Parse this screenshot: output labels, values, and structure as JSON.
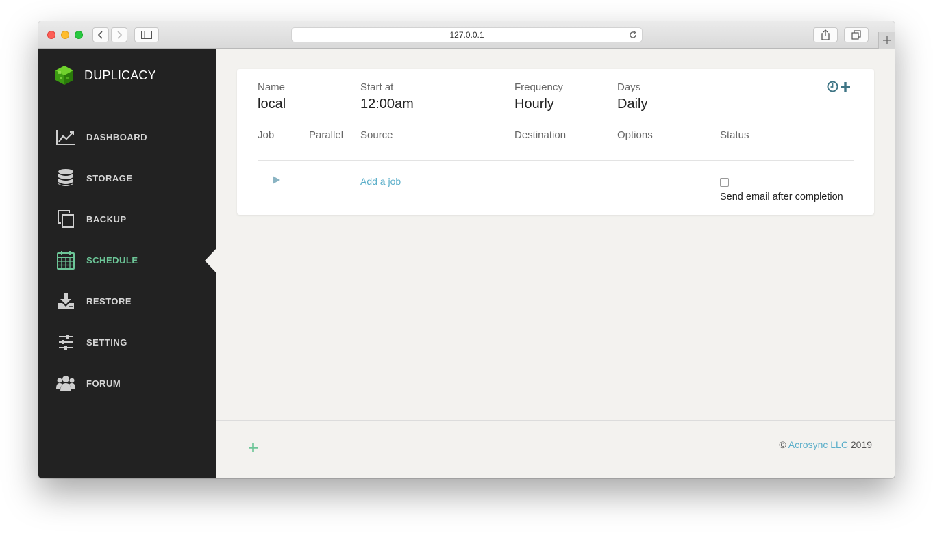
{
  "browser": {
    "url": "127.0.0.1"
  },
  "app": {
    "brand": "DUPLICACY",
    "brand_color": "#4caf1f"
  },
  "sidebar": {
    "items": [
      {
        "label": "DASHBOARD",
        "icon": "chart-line-icon",
        "active": false
      },
      {
        "label": "STORAGE",
        "icon": "database-icon",
        "active": false
      },
      {
        "label": "BACKUP",
        "icon": "copy-icon",
        "active": false
      },
      {
        "label": "SCHEDULE",
        "icon": "calendar-icon",
        "active": true
      },
      {
        "label": "RESTORE",
        "icon": "download-icon",
        "active": false
      },
      {
        "label": "SETTING",
        "icon": "sliders-icon",
        "active": false
      },
      {
        "label": "FORUM",
        "icon": "users-icon",
        "active": false
      }
    ],
    "active_color": "#6cc597"
  },
  "schedule": {
    "name_label": "Name",
    "name": "local",
    "start_label": "Start at",
    "start": "12:00am",
    "frequency_label": "Frequency",
    "frequency": "Hourly",
    "days_label": "Days",
    "days": "Daily",
    "columns": [
      "Job",
      "Parallel",
      "Source",
      "Destination",
      "Options",
      "Status"
    ],
    "add_job_label": "Add a job",
    "email_label": "Send email after completion",
    "email_checked": false
  },
  "footer": {
    "copyright_prefix": "©",
    "company": "Acrosync LLC",
    "year": "2019"
  }
}
